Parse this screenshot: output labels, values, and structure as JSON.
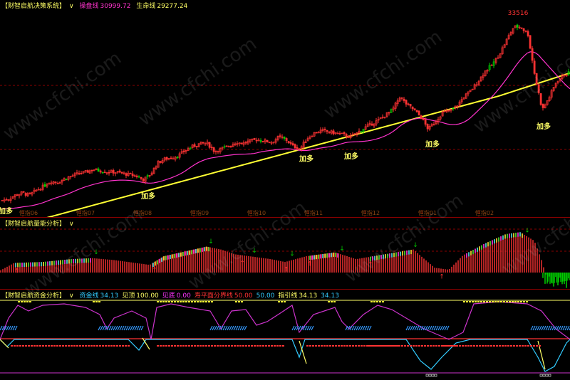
{
  "header1": {
    "title": "【财智启航决策系统】",
    "arrow": "∨",
    "ma1_label": "操盘线",
    "ma1_value": "30999.72",
    "ma2_label": "生命线",
    "ma2_value": "29277.24"
  },
  "header2": {
    "title": "【财智启航量能分析】",
    "arrow": "∨"
  },
  "header3": {
    "title": "【财智启航资金分析】",
    "arrow": "∨",
    "items": [
      {
        "label": "资金线",
        "value": "34.13",
        "color": "#33ccff"
      },
      {
        "label": "见顶",
        "value": "100.00",
        "color": "#ffff66"
      },
      {
        "label": "见底",
        "value": "0.00",
        "color": "#ff33ff"
      },
      {
        "label": "寿平面分界线",
        "value": "50.00",
        "color": "#ff3333"
      },
      {
        "label": "",
        "value": "50.00",
        "color": "#33ccff"
      },
      {
        "label": "指引线",
        "value": "34.13",
        "color": "#ffff66"
      },
      {
        "label": "",
        "value": "34.13",
        "color": "#33ccff"
      }
    ]
  },
  "watermark": "www.cfchi.com",
  "colors": {
    "up": "#ff3333",
    "down": "#00cc00",
    "ma1": "#ff33cc",
    "ma2": "#ffff33",
    "money": "#33ccff",
    "guide": "#ffff66",
    "border": "#8b0000"
  },
  "chart_data": [
    {
      "type": "candlestick",
      "title": "财智启航决策系统",
      "series": [
        {
          "name": "操盘线",
          "last": 30999.72
        },
        {
          "name": "生命线",
          "last": 29277.24
        }
      ],
      "peak_label": "33516",
      "close_points": [
        [
          0,
          19800
        ],
        [
          10,
          19900
        ],
        [
          20,
          20200
        ],
        [
          30,
          20400
        ],
        [
          40,
          20200
        ],
        [
          50,
          20600
        ],
        [
          60,
          20900
        ],
        [
          70,
          21300
        ],
        [
          80,
          21200
        ],
        [
          90,
          21500
        ],
        [
          100,
          21700
        ],
        [
          110,
          21900
        ],
        [
          120,
          22000
        ],
        [
          130,
          22200
        ],
        [
          140,
          22100
        ],
        [
          150,
          22000
        ],
        [
          160,
          22000
        ],
        [
          170,
          21900
        ],
        [
          180,
          21800
        ],
        [
          190,
          21700
        ],
        [
          200,
          21400
        ],
        [
          210,
          21800
        ],
        [
          220,
          22700
        ],
        [
          230,
          23000
        ],
        [
          240,
          23100
        ],
        [
          250,
          23300
        ],
        [
          260,
          23700
        ],
        [
          270,
          24000
        ],
        [
          280,
          24200
        ],
        [
          290,
          24200
        ],
        [
          300,
          23600
        ],
        [
          310,
          23800
        ],
        [
          320,
          24000
        ],
        [
          330,
          24300
        ],
        [
          340,
          24200
        ],
        [
          350,
          24400
        ],
        [
          360,
          24500
        ],
        [
          370,
          24400
        ],
        [
          380,
          24300
        ],
        [
          390,
          24700
        ],
        [
          400,
          24500
        ],
        [
          410,
          24000
        ],
        [
          420,
          23800
        ],
        [
          430,
          24600
        ],
        [
          440,
          25000
        ],
        [
          450,
          25200
        ],
        [
          460,
          25100
        ],
        [
          470,
          25000
        ],
        [
          480,
          24900
        ],
        [
          490,
          24700
        ],
        [
          500,
          25000
        ],
        [
          510,
          25400
        ],
        [
          520,
          25700
        ],
        [
          530,
          26000
        ],
        [
          540,
          26400
        ],
        [
          550,
          26800
        ],
        [
          560,
          27800
        ],
        [
          570,
          27200
        ],
        [
          580,
          26800
        ],
        [
          590,
          26200
        ],
        [
          600,
          25300
        ],
        [
          610,
          25900
        ],
        [
          620,
          26600
        ],
        [
          630,
          26700
        ],
        [
          640,
          27100
        ],
        [
          650,
          27800
        ],
        [
          660,
          28300
        ],
        [
          670,
          29000
        ],
        [
          680,
          29800
        ],
        [
          690,
          30300
        ],
        [
          700,
          31100
        ],
        [
          710,
          32200
        ],
        [
          720,
          33200
        ],
        [
          730,
          33200
        ],
        [
          740,
          32600
        ],
        [
          750,
          29300
        ],
        [
          760,
          26800
        ],
        [
          770,
          27800
        ],
        [
          780,
          29000
        ],
        [
          790,
          29500
        ],
        [
          800,
          29700
        ]
      ],
      "signals": [
        {
          "label": "加多",
          "x": 8
        },
        {
          "label": "加多",
          "x": 208
        },
        {
          "label": "加多",
          "x": 430
        },
        {
          "label": "加多",
          "x": 493
        },
        {
          "label": "加多",
          "x": 607
        },
        {
          "label": "加多",
          "x": 763
        }
      ],
      "x_tick_labels": [
        "恒指06",
        "恒指07",
        "恒指08",
        "恒指09",
        "恒指10",
        "恒指11",
        "恒指12",
        "恒指01",
        "恒指02"
      ]
    },
    {
      "type": "bar",
      "title": "财智启航量能分析",
      "note": "energy histogram, values in indicator units (positive red/green band, negative green at end)",
      "points": [
        [
          0,
          2
        ],
        [
          20,
          10
        ],
        [
          60,
          11
        ],
        [
          100,
          14
        ],
        [
          130,
          15
        ],
        [
          160,
          13
        ],
        [
          190,
          10
        ],
        [
          210,
          8
        ],
        [
          230,
          17
        ],
        [
          260,
          22
        ],
        [
          290,
          27
        ],
        [
          310,
          24
        ],
        [
          330,
          19
        ],
        [
          350,
          17
        ],
        [
          380,
          14
        ],
        [
          400,
          11
        ],
        [
          430,
          17
        ],
        [
          470,
          21
        ],
        [
          500,
          14
        ],
        [
          540,
          19
        ],
        [
          580,
          24
        ],
        [
          610,
          5
        ],
        [
          630,
          3
        ],
        [
          650,
          18
        ],
        [
          680,
          30
        ],
        [
          710,
          40
        ],
        [
          730,
          42
        ],
        [
          750,
          33
        ],
        [
          760,
          13
        ],
        [
          770,
          -12
        ],
        [
          800,
          -8
        ]
      ]
    },
    {
      "type": "line",
      "title": "财智启航资金分析",
      "series": [
        {
          "name": "资金线",
          "last": 34.13
        },
        {
          "name": "指引线",
          "last": 34.13
        }
      ],
      "levels": {
        "见顶": 100,
        "见底": 0,
        "寿平面分界线": 50
      }
    }
  ]
}
